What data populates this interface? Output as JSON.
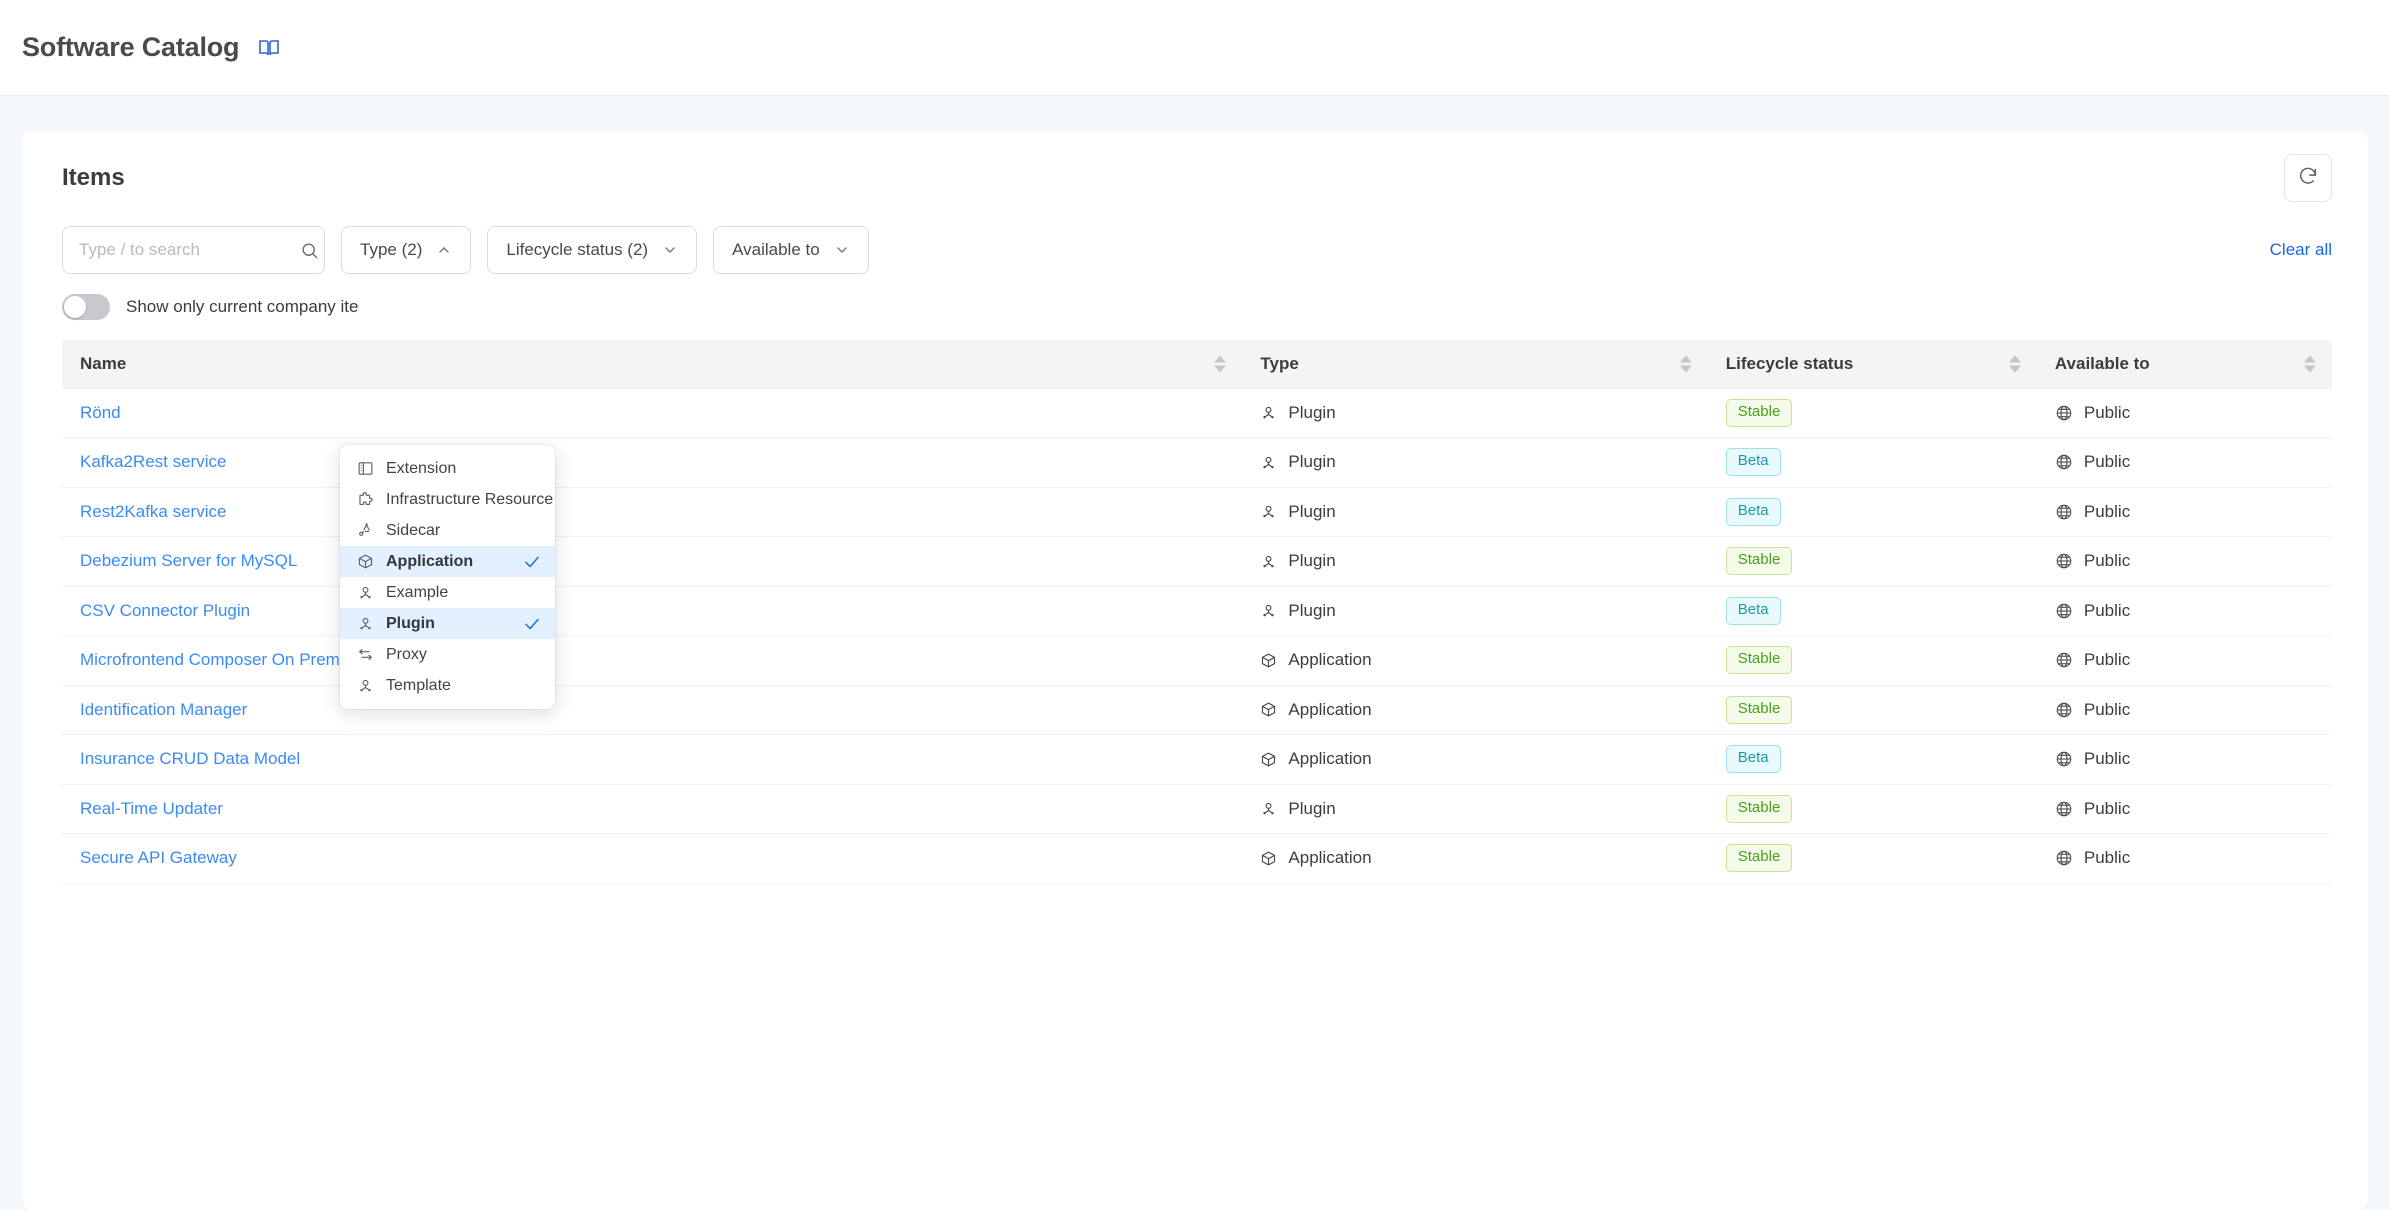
{
  "header": {
    "title": "Software Catalog",
    "book_icon": "book-icon"
  },
  "card": {
    "title": "Items",
    "refresh_icon": "refresh-icon"
  },
  "search": {
    "placeholder": "Type / to search",
    "value": "",
    "icon": "search-icon"
  },
  "filters": {
    "type": {
      "label": "Type (2)",
      "expanded": true
    },
    "lifecycle": {
      "label": "Lifecycle status (2)",
      "expanded": false
    },
    "available": {
      "label": "Available to",
      "expanded": false
    },
    "clear_all": "Clear all"
  },
  "toggle": {
    "label": "Show only current company ite",
    "on": false
  },
  "type_dropdown": {
    "items": [
      {
        "label": "Extension",
        "icon": "panel-icon",
        "selected": false
      },
      {
        "label": "Infrastructure Resource",
        "icon": "puzzle-icon",
        "selected": false
      },
      {
        "label": "Sidecar",
        "icon": "sidecar-icon",
        "selected": false
      },
      {
        "label": "Application",
        "icon": "box-icon",
        "selected": true
      },
      {
        "label": "Example",
        "icon": "plugin-icon",
        "selected": false
      },
      {
        "label": "Plugin",
        "icon": "plugin-icon",
        "selected": true
      },
      {
        "label": "Proxy",
        "icon": "proxy-icon",
        "selected": false
      },
      {
        "label": "Template",
        "icon": "plugin-icon",
        "selected": false
      }
    ]
  },
  "table": {
    "columns": [
      "Name",
      "Type",
      "Lifecycle status",
      "Available to"
    ],
    "rows": [
      {
        "name": "Rönd",
        "type": "Plugin",
        "type_icon": "plugin-icon",
        "status": "Stable",
        "available": "Public"
      },
      {
        "name": "Kafka2Rest service",
        "type": "Plugin",
        "type_icon": "plugin-icon",
        "status": "Beta",
        "available": "Public"
      },
      {
        "name": "Rest2Kafka service",
        "type": "Plugin",
        "type_icon": "plugin-icon",
        "status": "Beta",
        "available": "Public"
      },
      {
        "name": "Debezium Server for MySQL",
        "type": "Plugin",
        "type_icon": "plugin-icon",
        "status": "Stable",
        "available": "Public"
      },
      {
        "name": "CSV Connector Plugin",
        "type": "Plugin",
        "type_icon": "plugin-icon",
        "status": "Beta",
        "available": "Public"
      },
      {
        "name": "Microfrontend Composer On Prem Toolkit",
        "type": "Application",
        "type_icon": "box-icon",
        "status": "Stable",
        "available": "Public"
      },
      {
        "name": "Identification Manager",
        "type": "Application",
        "type_icon": "box-icon",
        "status": "Stable",
        "available": "Public"
      },
      {
        "name": "Insurance CRUD Data Model",
        "type": "Application",
        "type_icon": "box-icon",
        "status": "Beta",
        "available": "Public"
      },
      {
        "name": "Real-Time Updater",
        "type": "Plugin",
        "type_icon": "plugin-icon",
        "status": "Stable",
        "available": "Public"
      },
      {
        "name": "Secure API Gateway",
        "type": "Application",
        "type_icon": "box-icon",
        "status": "Stable",
        "available": "Public"
      }
    ]
  },
  "colors": {
    "link": "#3b8bf4",
    "accent": "#1a66e0",
    "stable": "#49a020",
    "beta": "#1f9aac",
    "page_bg": "#f4f7fb"
  }
}
